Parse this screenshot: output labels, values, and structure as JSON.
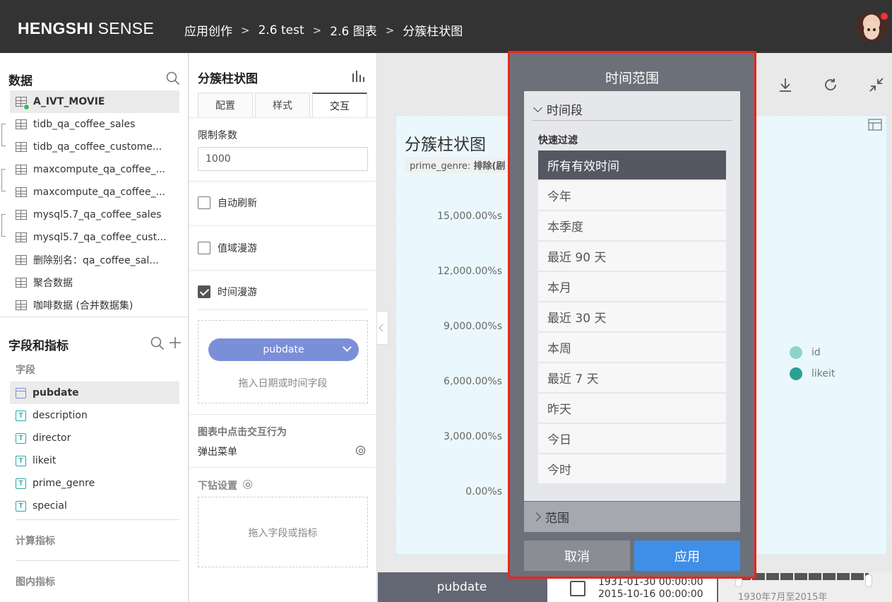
{
  "header": {
    "logo_bold": "HENGSHI",
    "logo_light": "SENSE",
    "breadcrumb": [
      "应用创作",
      "2.6 test",
      "2.6 图表",
      "分簇柱状图"
    ]
  },
  "data_panel": {
    "title": "数据",
    "datasets": [
      "A_IVT_MOVIE",
      "tidb_qa_coffee_sales",
      "tidb_qa_coffee_custome...",
      "maxcompute_qa_coffee_...",
      "maxcompute_qa_coffee_...",
      "mysql5.7_qa_coffee_sales",
      "mysql5.7_qa_coffee_cust...",
      "删除别名：qa_coffee_sal...",
      "聚合数据",
      "咖啡数据 (合并数据集)"
    ]
  },
  "fields_panel": {
    "title": "字段和指标",
    "fields_label": "字段",
    "fields": [
      "pubdate",
      "description",
      "director",
      "likeit",
      "prime_genre",
      "special"
    ],
    "calc_label": "计算指标",
    "inchart_label": "图内指标"
  },
  "config": {
    "title": "分簇柱状图",
    "tabs": [
      "配置",
      "样式",
      "交互"
    ],
    "limit_label": "限制条数",
    "limit_value": "1000",
    "auto_refresh": "自动刷新",
    "value_roam": "值域漫游",
    "time_roam": "时间漫游",
    "time_field": "pubdate",
    "drop_date_hint": "拖入日期或时间字段",
    "click_behavior_label": "图表中点击交互行为",
    "click_behavior_value": "弹出菜单",
    "drill_label": "下钻设置",
    "drop_field_hint": "拖入字段或指标"
  },
  "chart": {
    "title": "分簇柱状图",
    "filter_key": "prime_genre:",
    "filter_value": "排除(剧",
    "y_ticks": [
      "15,000.00%s",
      "12,000.00%s",
      "9,000.00%s",
      "6,000.00%s",
      "3,000.00%s",
      "0.00%s"
    ],
    "legend": [
      {
        "name": "id",
        "color": "#8fd3cf"
      },
      {
        "name": "likeit",
        "color": "#2aa192"
      }
    ]
  },
  "bottom_bar": {
    "field": "pubdate",
    "date_start": "1931-01-30 00:00:00",
    "date_end": "2015-10-16 00:00:00",
    "range_text": "1930年7月至2015年"
  },
  "modal": {
    "title": "时间范围",
    "section_open": "时间段",
    "quick_filter_label": "快速过滤",
    "options": [
      "所有有效时间",
      "今年",
      "本季度",
      "最近 90 天",
      "本月",
      "最近 30 天",
      "本周",
      "最近 7 天",
      "昨天",
      "今日",
      "今时"
    ],
    "selected_index": 0,
    "section_closed": "范围",
    "cancel": "取消",
    "apply": "应用"
  }
}
